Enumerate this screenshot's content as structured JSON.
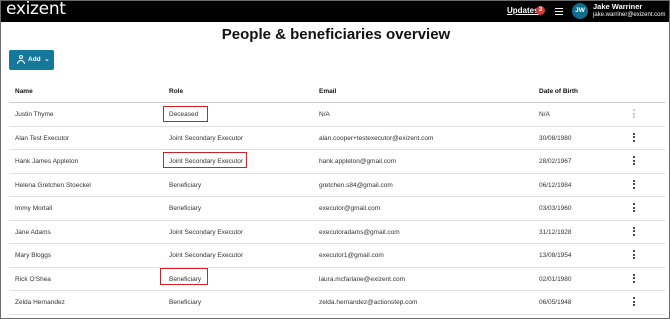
{
  "header": {
    "logo": "exizent",
    "updates_label": "Updates",
    "updates_count": "3",
    "user_initials": "JW",
    "user_name": "Jake Warriner",
    "user_email": "jake.warriner@exizent.com"
  },
  "page": {
    "title": "People & beneficiaries overview",
    "add_button_label": "Add"
  },
  "table": {
    "columns": [
      "Name",
      "Role",
      "Email",
      "Date of Birth"
    ],
    "rows": [
      {
        "name": "Justin Thyme",
        "role": "Deceased",
        "email": "N/A",
        "dob": "N/A"
      },
      {
        "name": "Alan Test Executor",
        "role": "Joint Secondary Executor",
        "email": "alan.cooper+testexecutor@exizent.com",
        "dob": "30/08/1980"
      },
      {
        "name": "Hank James Appleton",
        "role": "Joint Secondary Executor",
        "email": "hank.appleton@gmail.com",
        "dob": "28/02/1967"
      },
      {
        "name": "Helena Gretchen Stoeckel",
        "role": "Beneficiary",
        "email": "gretchen.s84@gmail.com",
        "dob": "06/12/1984"
      },
      {
        "name": "Immy Mortall",
        "role": "Beneficiary",
        "email": "executor@gmail.com",
        "dob": "03/03/1960"
      },
      {
        "name": "Jane Adams",
        "role": "Joint Secondary Executor",
        "email": "executoradams@gmail.com",
        "dob": "31/12/1928"
      },
      {
        "name": "Mary Bloggs",
        "role": "Joint Secondary Executor",
        "email": "executor1@gmail.com",
        "dob": "13/08/1954"
      },
      {
        "name": "Rick O'Shea",
        "role": "Beneficiary",
        "email": "laura.mcfarlane@exizent.com",
        "dob": "02/01/1980"
      },
      {
        "name": "Zelda Hernandez",
        "role": "Beneficiary",
        "email": "zelda.hernandez@actionstep.com",
        "dob": "06/05/1948"
      }
    ]
  },
  "colors": {
    "topbar": "#000000",
    "accent": "#16789a",
    "highlight": "#d0202a",
    "badge": "#d83a3a"
  }
}
